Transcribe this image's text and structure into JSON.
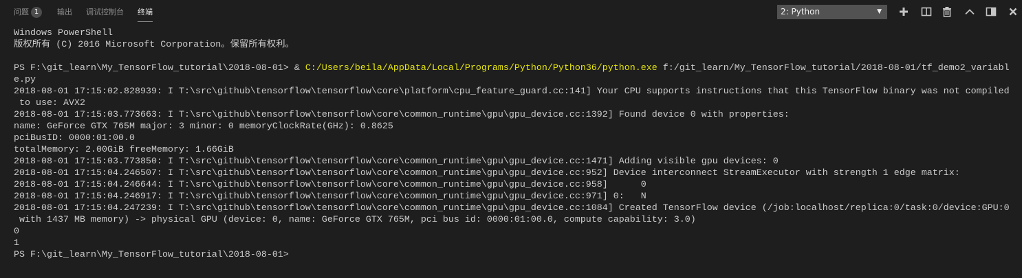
{
  "panel": {
    "tabs": [
      {
        "label": "问题",
        "badge": "1"
      },
      {
        "label": "输出"
      },
      {
        "label": "调试控制台"
      },
      {
        "label": "终端",
        "active": true
      }
    ],
    "terminal_select": "2: Python",
    "icons": [
      "plus-icon",
      "split-icon",
      "trash-icon",
      "chevron-up-icon",
      "maximize-panel-icon",
      "close-icon"
    ]
  },
  "colors": {
    "background": "#1e1e1e",
    "text": "#cccccc",
    "path_highlight": "#e5e510"
  },
  "terminal": {
    "lines": [
      [
        {
          "t": "Windows PowerShell"
        }
      ],
      [
        {
          "t": "版权所有 (C) 2016 Microsoft Corporation。保留所有权利。"
        }
      ],
      [
        {
          "t": ""
        }
      ],
      [
        {
          "t": "PS F:\\git_learn\\My_TensorFlow_tutorial\\2018-08-01> & "
        },
        {
          "t": "C:/Users/beila/AppData/Local/Programs/Python/Python36/python.exe",
          "hl": true
        },
        {
          "t": " f:/git_learn/My_TensorFlow_tutorial/2018-08-01/tf_demo2_variabl"
        }
      ],
      [
        {
          "t": "e.py"
        }
      ],
      [
        {
          "t": "2018-08-01 17:15:02.828939: I T:\\src\\github\\tensorflow\\tensorflow\\core\\platform\\cpu_feature_guard.cc:141] Your CPU supports instructions that this TensorFlow binary was not compiled"
        }
      ],
      [
        {
          "t": " to use: AVX2"
        }
      ],
      [
        {
          "t": "2018-08-01 17:15:03.773663: I T:\\src\\github\\tensorflow\\tensorflow\\core\\common_runtime\\gpu\\gpu_device.cc:1392] Found device 0 with properties:"
        }
      ],
      [
        {
          "t": "name: GeForce GTX 765M major: 3 minor: 0 memoryClockRate(GHz): 0.8625"
        }
      ],
      [
        {
          "t": "pciBusID: 0000:01:00.0"
        }
      ],
      [
        {
          "t": "totalMemory: 2.00GiB freeMemory: 1.66GiB"
        }
      ],
      [
        {
          "t": "2018-08-01 17:15:03.773850: I T:\\src\\github\\tensorflow\\tensorflow\\core\\common_runtime\\gpu\\gpu_device.cc:1471] Adding visible gpu devices: 0"
        }
      ],
      [
        {
          "t": "2018-08-01 17:15:04.246507: I T:\\src\\github\\tensorflow\\tensorflow\\core\\common_runtime\\gpu\\gpu_device.cc:952] Device interconnect StreamExecutor with strength 1 edge matrix:"
        }
      ],
      [
        {
          "t": "2018-08-01 17:15:04.246644: I T:\\src\\github\\tensorflow\\tensorflow\\core\\common_runtime\\gpu\\gpu_device.cc:958]      0"
        }
      ],
      [
        {
          "t": "2018-08-01 17:15:04.246917: I T:\\src\\github\\tensorflow\\tensorflow\\core\\common_runtime\\gpu\\gpu_device.cc:971] 0:   N"
        }
      ],
      [
        {
          "t": "2018-08-01 17:15:04.247239: I T:\\src\\github\\tensorflow\\tensorflow\\core\\common_runtime\\gpu\\gpu_device.cc:1084] Created TensorFlow device (/job:localhost/replica:0/task:0/device:GPU:0"
        }
      ],
      [
        {
          "t": " with 1437 MB memory) -> physical GPU (device: 0, name: GeForce GTX 765M, pci bus id: 0000:01:00.0, compute capability: 3.0)"
        }
      ],
      [
        {
          "t": "0"
        }
      ],
      [
        {
          "t": "1"
        }
      ],
      [
        {
          "t": "PS F:\\git_learn\\My_TensorFlow_tutorial\\2018-08-01>"
        }
      ]
    ]
  }
}
